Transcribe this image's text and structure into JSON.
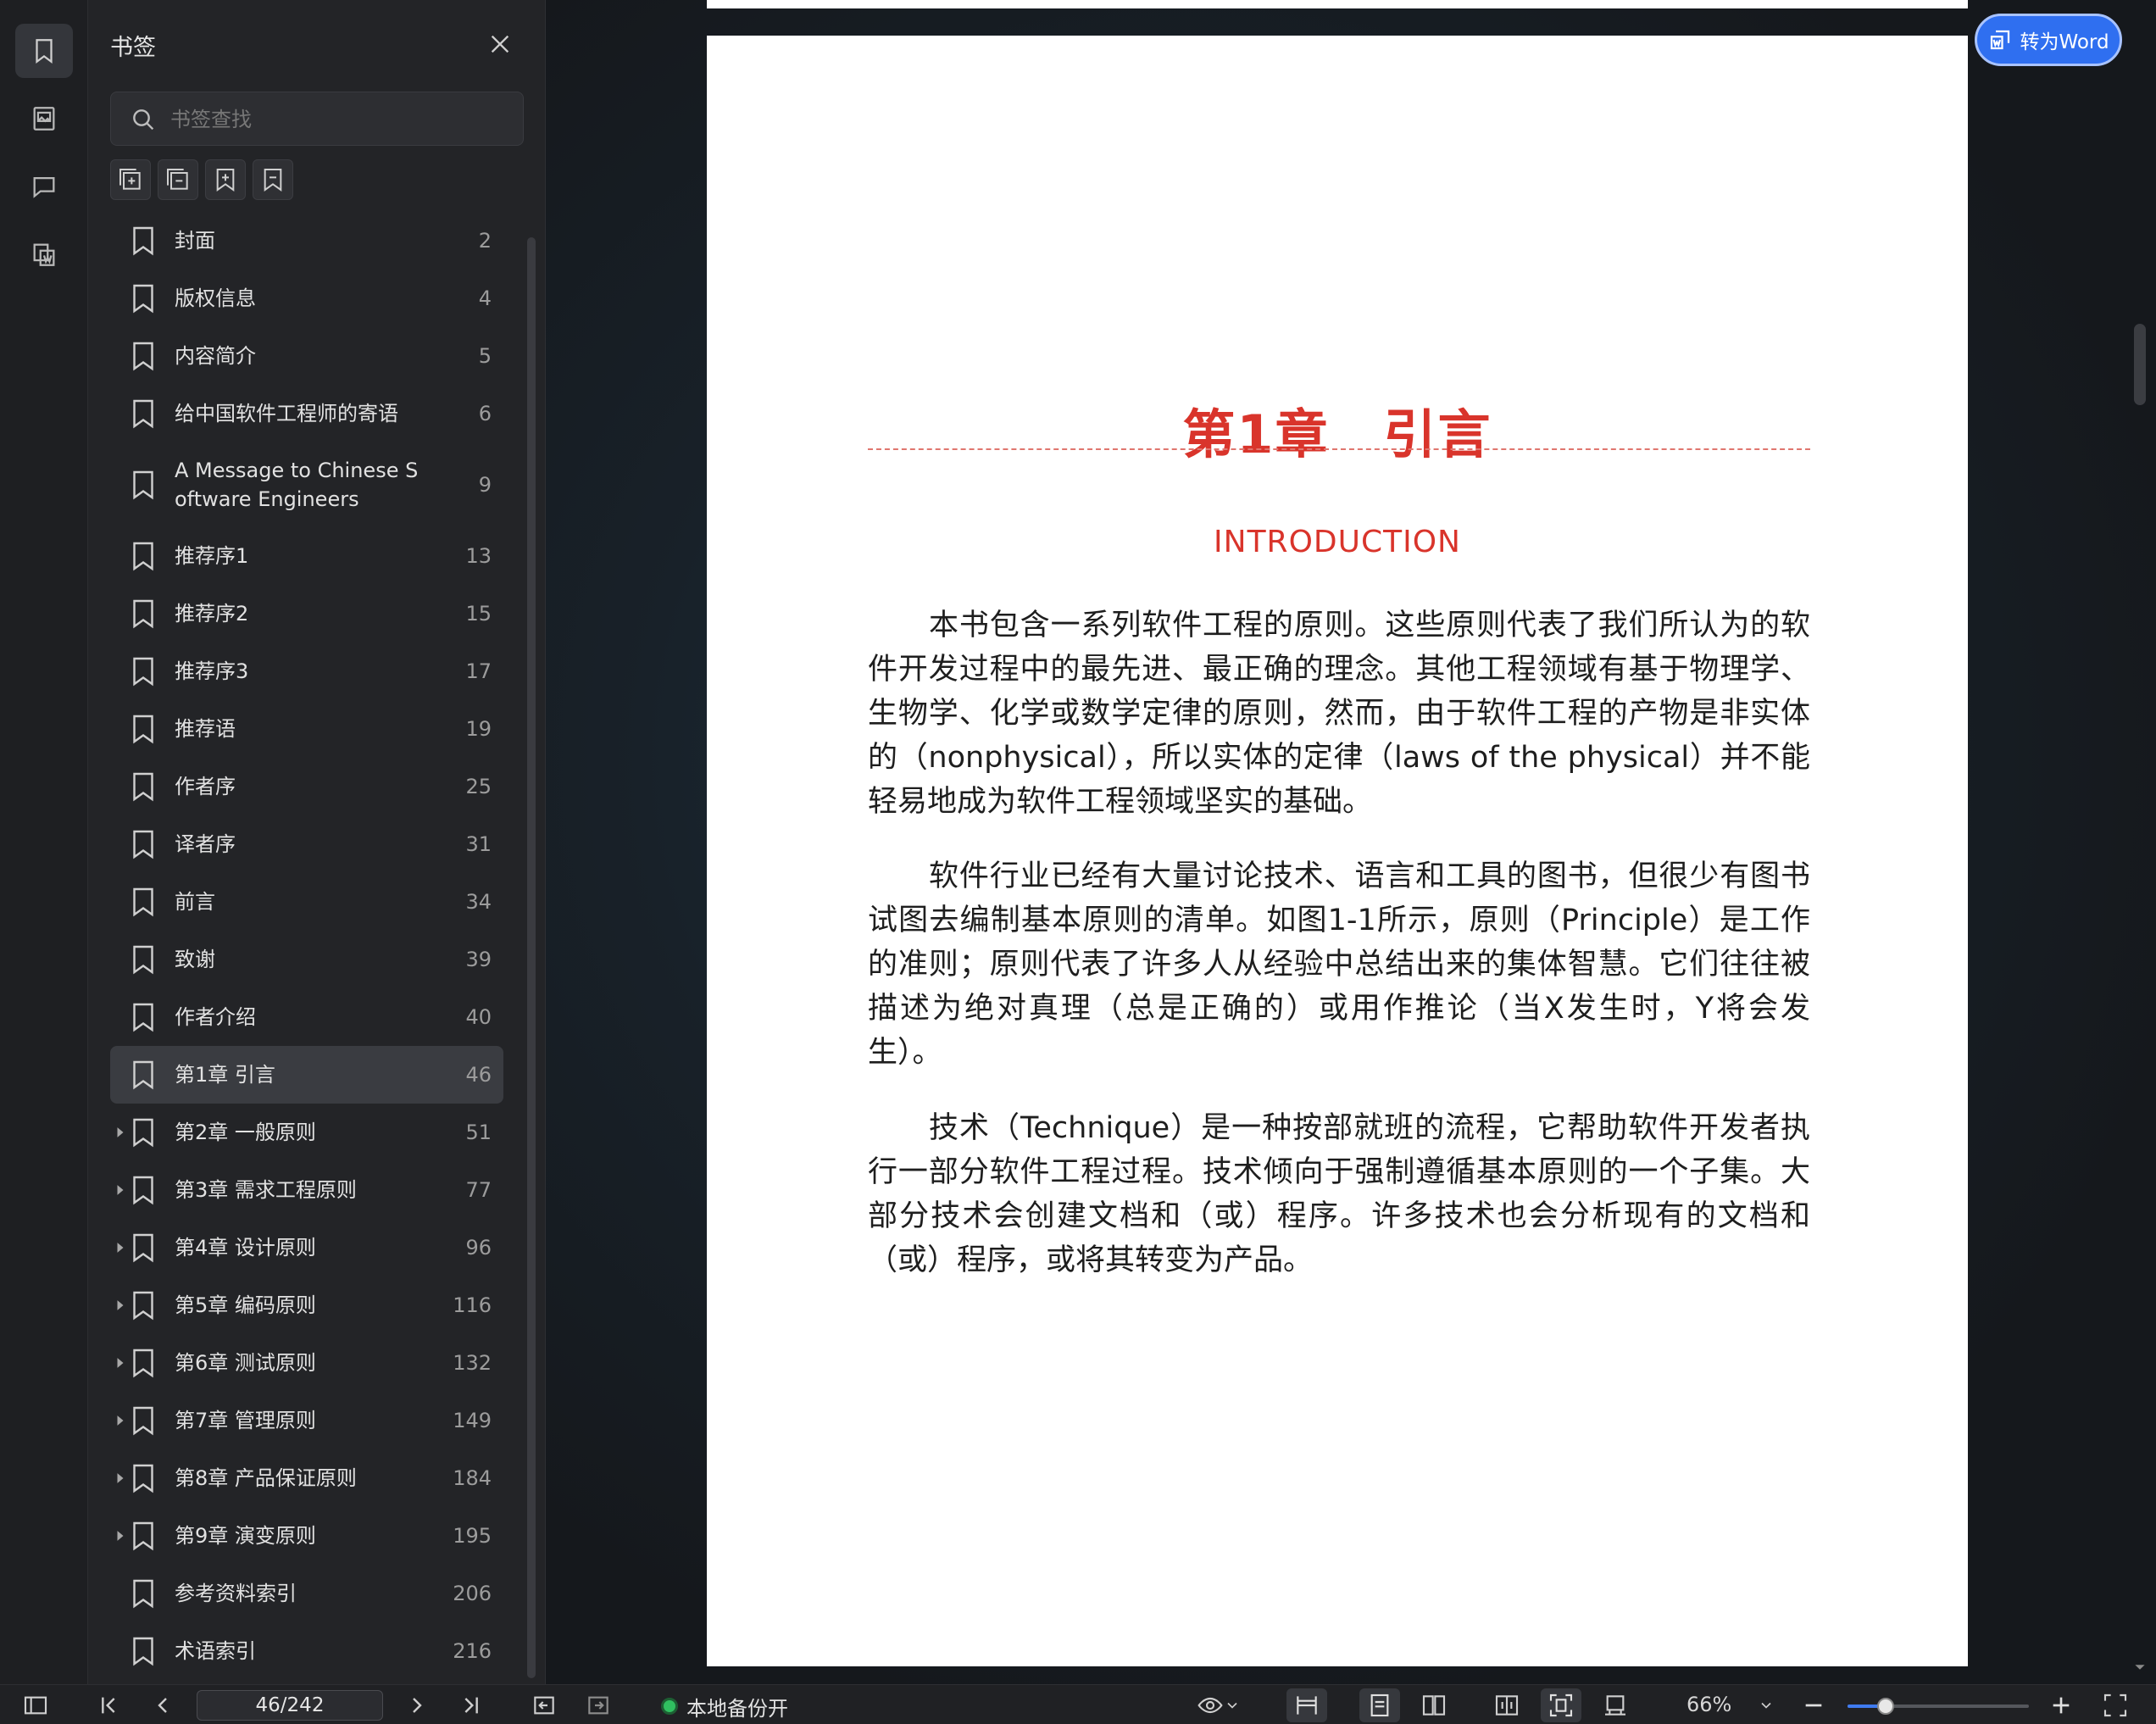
{
  "panel": {
    "title": "书签",
    "search_placeholder": "书签查找"
  },
  "bookmarks": [
    {
      "label": "封面",
      "page": "2",
      "expandable": false
    },
    {
      "label": "版权信息",
      "page": "4",
      "expandable": false
    },
    {
      "label": "内容简介",
      "page": "5",
      "expandable": false
    },
    {
      "label": "给中国软件工程师的寄语",
      "page": "6",
      "expandable": false
    },
    {
      "label": "A Message to Chinese Software Engineers",
      "page": "9",
      "expandable": false
    },
    {
      "label": "推荐序1",
      "page": "13",
      "expandable": false
    },
    {
      "label": "推荐序2",
      "page": "15",
      "expandable": false
    },
    {
      "label": "推荐序3",
      "page": "17",
      "expandable": false
    },
    {
      "label": "推荐语",
      "page": "19",
      "expandable": false
    },
    {
      "label": "作者序",
      "page": "25",
      "expandable": false
    },
    {
      "label": "译者序",
      "page": "31",
      "expandable": false
    },
    {
      "label": "前言",
      "page": "34",
      "expandable": false
    },
    {
      "label": "致谢",
      "page": "39",
      "expandable": false
    },
    {
      "label": "作者介绍",
      "page": "40",
      "expandable": false
    },
    {
      "label": "第1章 引言",
      "page": "46",
      "expandable": false,
      "selected": true
    },
    {
      "label": "第2章 一般原则",
      "page": "51",
      "expandable": true
    },
    {
      "label": "第3章 需求工程原则",
      "page": "77",
      "expandable": true
    },
    {
      "label": "第4章 设计原则",
      "page": "96",
      "expandable": true
    },
    {
      "label": "第5章 编码原则",
      "page": "116",
      "expandable": true
    },
    {
      "label": "第6章 测试原则",
      "page": "132",
      "expandable": true
    },
    {
      "label": "第7章 管理原则",
      "page": "149",
      "expandable": true
    },
    {
      "label": "第8章 产品保证原则",
      "page": "184",
      "expandable": true
    },
    {
      "label": "第9章 演变原则",
      "page": "195",
      "expandable": true
    },
    {
      "label": "参考资料索引",
      "page": "206",
      "expandable": false
    },
    {
      "label": "术语索引",
      "page": "216",
      "expandable": false
    }
  ],
  "document": {
    "chapter_title": "第1章　引言",
    "subtitle": "INTRODUCTION",
    "paragraphs": [
      "本书包含一系列软件工程的原则。这些原则代表了我们所认为的软件开发过程中的最先进、最正确的理念。其他工程领域有基于物理学、生物学、化学或数学定律的原则，然而，由于软件工程的产物是非实体的（nonphysical），所以实体的定律（laws of the physical）并不能轻易地成为软件工程领域坚实的基础。",
      "软件行业已经有大量讨论技术、语言和工具的图书，但很少有图书试图去编制基本原则的清单。如图1-1所示，原则（Principle）是工作的准则；原则代表了许多人从经验中总结出来的集体智慧。它们往往被描述为绝对真理（总是正确的）或用作推论（当X发生时，Y将会发生）。",
      "技术（Technique）是一种按部就班的流程，它帮助软件开发者执行一部分软件工程过程。技术倾向于强制遵循基本原则的一个子集。大部分技术会创建文档和（或）程序。许多技术也会分析现有的文档和（或）程序，或将其转变为产品。"
    ],
    "to_word_label": "转为Word"
  },
  "statusbar": {
    "page_indicator": "46/242",
    "backup_label": "本地备份开",
    "zoom_label": "66%",
    "zoom_level": 0.21
  },
  "colors": {
    "accent": "#2f6ff0",
    "chapter_red": "#d9342b",
    "backup_green": "#30c060"
  }
}
